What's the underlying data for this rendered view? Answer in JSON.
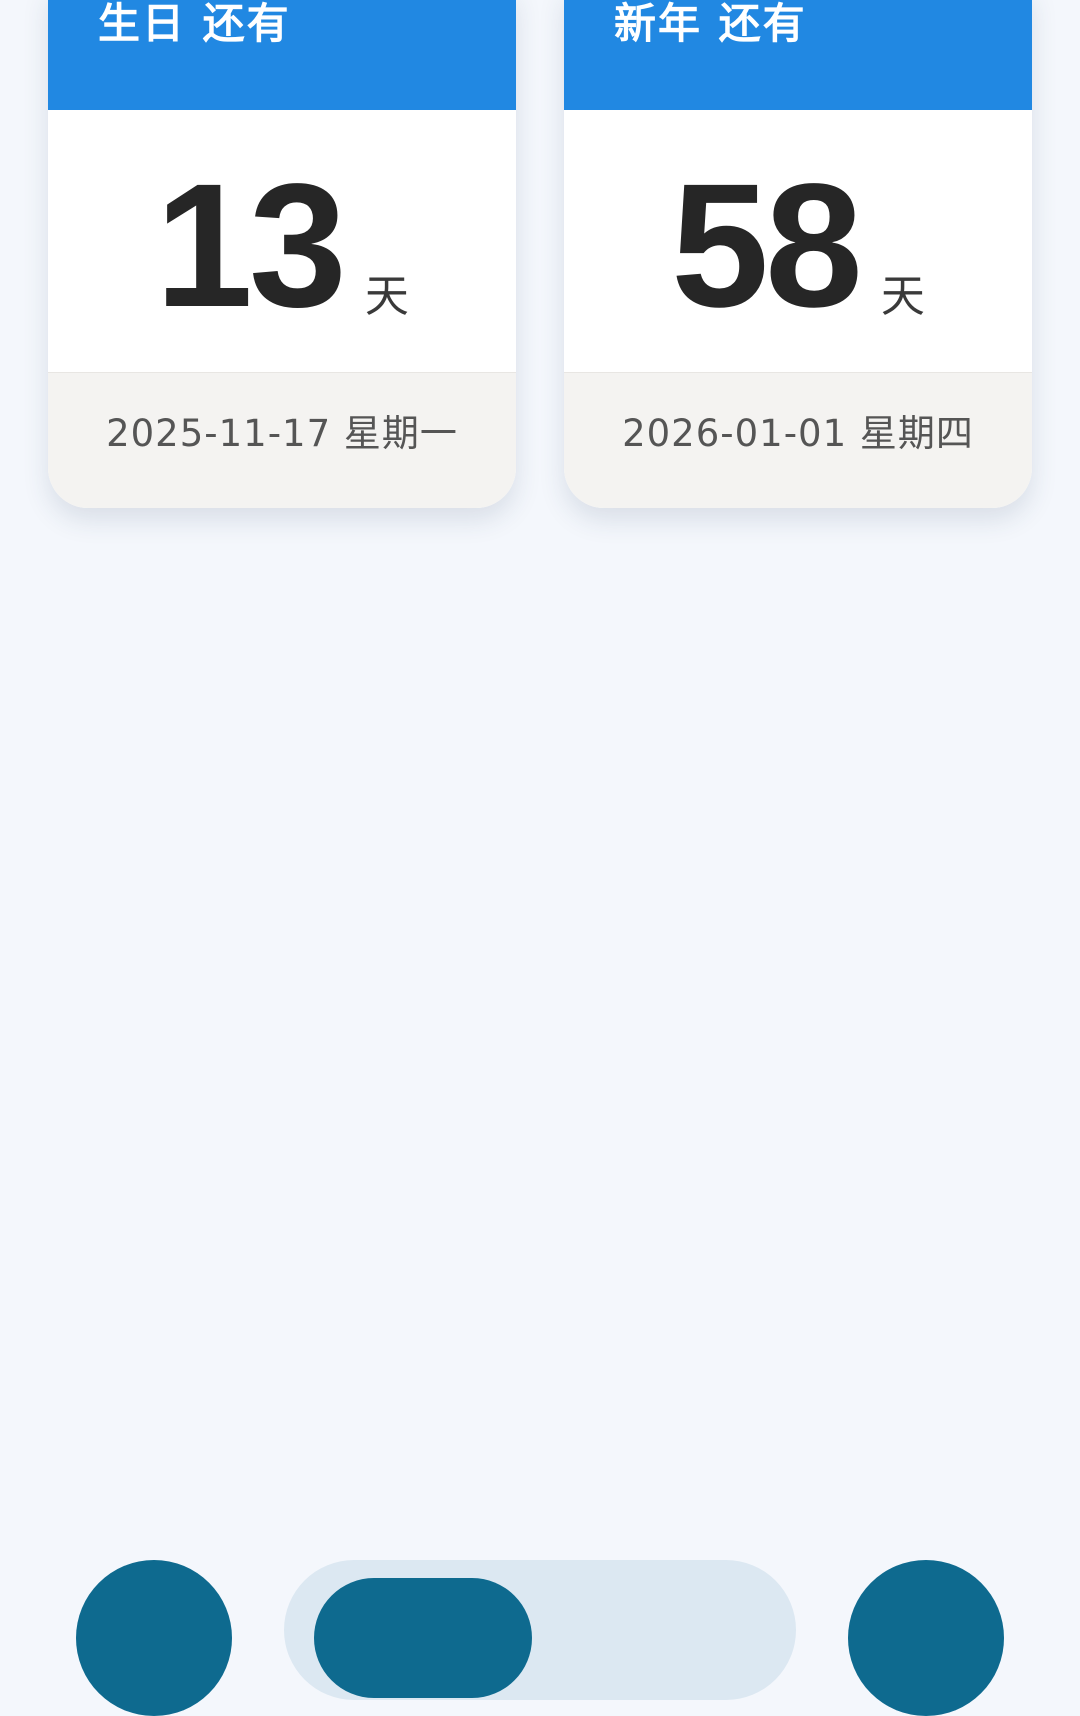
{
  "cards": {
    "birthday": {
      "title": "生日 还有",
      "count": "13",
      "unit": "天",
      "date": "2025-11-17 星期一"
    },
    "newyear": {
      "title": "新年 还有",
      "count": "58",
      "unit": "天",
      "date": "2026-01-01 星期四"
    }
  },
  "colors": {
    "header_blue": "#2188e2",
    "nav_accent": "#0e6a8f",
    "page_background": "#f4f7fc"
  }
}
